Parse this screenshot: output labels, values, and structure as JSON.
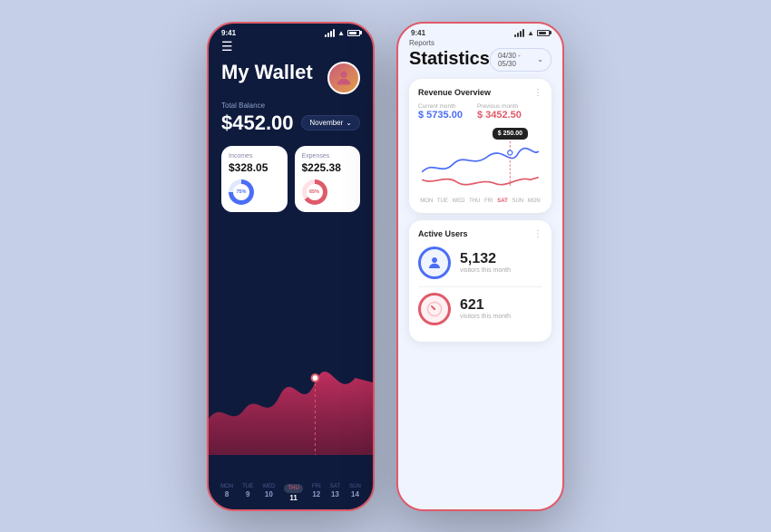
{
  "left_phone": {
    "status_time": "9:41",
    "header": {
      "menu_icon": "☰",
      "title": "My Wallet",
      "avatar_emoji": "👤"
    },
    "balance": {
      "label": "Total Balance",
      "amount": "$452.00",
      "month_label": "November",
      "chevron": "⌄"
    },
    "cards": [
      {
        "label": "Incomes",
        "amount": "$328.05",
        "percent": "75%",
        "type": "blue"
      },
      {
        "label": "Expenses",
        "amount": "$225.38",
        "percent": "65%",
        "type": "red"
      }
    ],
    "days": [
      {
        "name": "MON",
        "num": "8",
        "active": false
      },
      {
        "name": "TUE",
        "num": "9",
        "active": false
      },
      {
        "name": "WED",
        "num": "10",
        "active": false
      },
      {
        "name": "THU",
        "num": "11",
        "active": true
      },
      {
        "name": "FRI",
        "num": "12",
        "active": false
      },
      {
        "name": "SAT",
        "num": "13",
        "active": false
      },
      {
        "name": "SUN",
        "num": "14",
        "active": false
      }
    ]
  },
  "right_phone": {
    "status_time": "9:41",
    "reports_label": "Reports",
    "title": "Statistics",
    "date_range": "04/30 - 05/30",
    "chevron": "⌄",
    "revenue_card": {
      "title": "Revenue Overview",
      "current_month_label": "Current month",
      "current_month_val": "$ 5735.00",
      "prev_month_label": "Previous month",
      "prev_month_val": "$ 3452.50",
      "tooltip": "$ 250.00",
      "days": [
        "MON",
        "TUE",
        "WED",
        "THU",
        "FRI",
        "SAT",
        "SUN",
        "MON"
      ]
    },
    "active_users": {
      "title": "Active Users",
      "stats": [
        {
          "icon_type": "person",
          "count": "5,132",
          "label": "visitors this month"
        },
        {
          "icon_type": "gauge",
          "count": "621",
          "label": "visitors this month"
        }
      ]
    }
  },
  "colors": {
    "brand_red": "#e05a6a",
    "brand_blue": "#4a6ef5",
    "dark_bg": "#0f1b3d",
    "light_bg": "#f0f4ff",
    "body_bg": "#c5cfe8"
  }
}
